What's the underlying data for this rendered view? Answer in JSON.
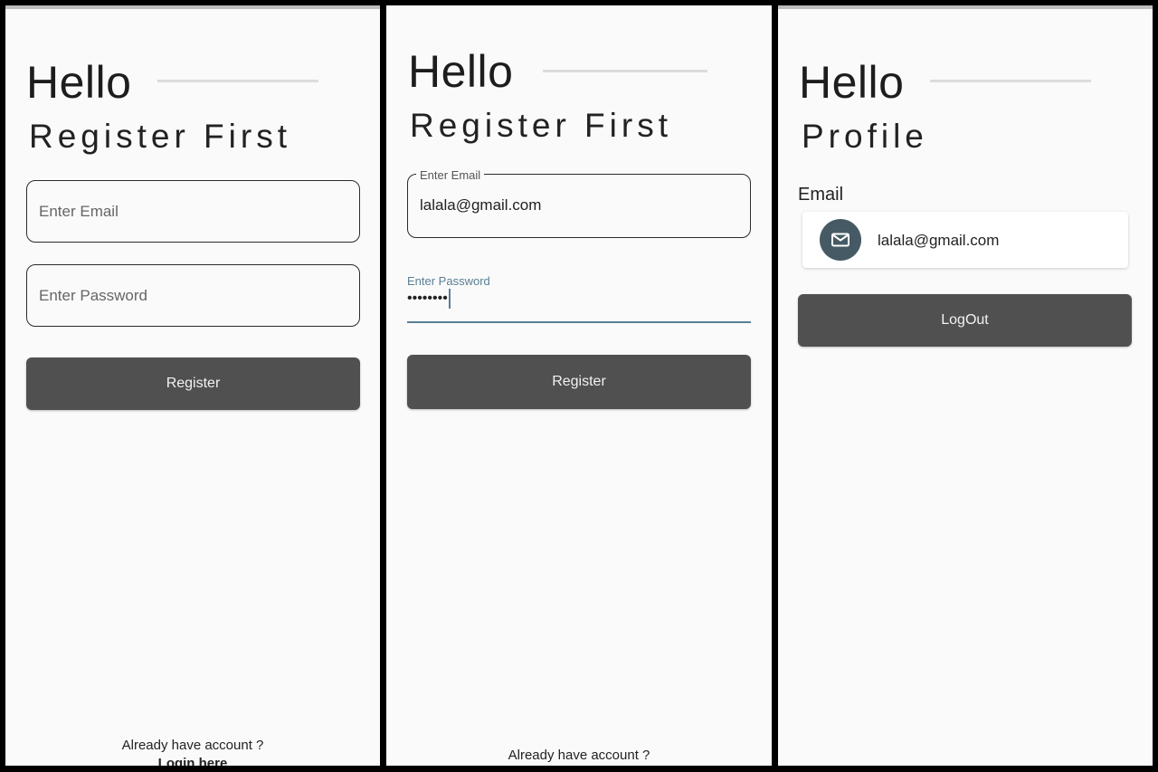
{
  "screen1": {
    "hello": "Hello",
    "subtitle": "Register First",
    "email_placeholder": "Enter Email",
    "password_placeholder": "Enter Password",
    "register_label": "Register",
    "footer_question": "Already have account ?",
    "footer_link": "Login here"
  },
  "screen2": {
    "hello": "Hello",
    "subtitle": "Register First",
    "email_label": "Enter Email",
    "email_value": "lalala@gmail.com",
    "password_label": "Enter Password",
    "password_value": "••••••••",
    "register_label": "Register",
    "footer_question": "Already have account ?"
  },
  "screen3": {
    "hello": "Hello",
    "subtitle": "Profile",
    "email_label": "Email",
    "email_value": "lalala@gmail.com",
    "email_icon": "mail-icon",
    "logout_label": "LogOut"
  },
  "colors": {
    "button": "#505050",
    "accent": "#5a7f94",
    "avatar": "#455a64"
  }
}
